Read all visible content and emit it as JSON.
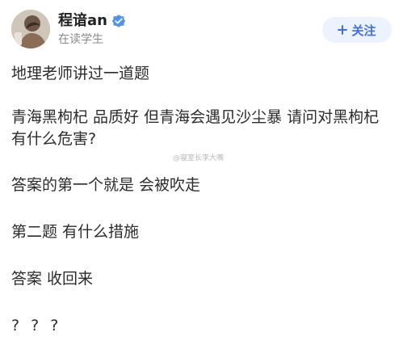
{
  "post": {
    "author": {
      "name": "程谙an",
      "subtitle": "在读学生",
      "avatar_icon": "profile-photo-avatar",
      "verified_icon": "verified-badge-icon"
    },
    "follow_button": {
      "label": "关注",
      "icon": "plus-icon",
      "color": "#3f6ee8",
      "background": "#edf2ff"
    },
    "content": [
      "地理老师讲过一道题",
      "青海黑枸杞 品质好 但青海会遇见沙尘暴 请问对黑枸杞",
      "有什么危害?",
      "答案的第一个就是 会被吹走",
      "第二题 有什么措施",
      "答案 收回来",
      "? ? ?"
    ],
    "watermark": "@寝室长李大嘴"
  }
}
